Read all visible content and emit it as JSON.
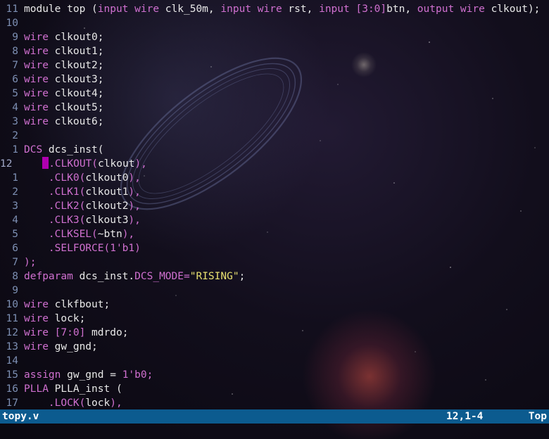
{
  "lines": [
    {
      "num": "11",
      "cur": false,
      "tokens": [
        {
          "t": "module top (",
          "c": ""
        },
        {
          "t": "input",
          "c": "kw"
        },
        {
          "t": " ",
          "c": ""
        },
        {
          "t": "wire",
          "c": "kw"
        },
        {
          "t": " clk_50m, ",
          "c": ""
        },
        {
          "t": "input",
          "c": "kw"
        },
        {
          "t": " ",
          "c": ""
        },
        {
          "t": "wire",
          "c": "kw"
        },
        {
          "t": " rst, ",
          "c": ""
        },
        {
          "t": "input",
          "c": "kw"
        },
        {
          "t": " [3:0]",
          "c": "kw"
        },
        {
          "t": "btn, ",
          "c": ""
        },
        {
          "t": "output",
          "c": "kw"
        },
        {
          "t": " ",
          "c": ""
        },
        {
          "t": "wire",
          "c": "kw"
        },
        {
          "t": " clkout);",
          "c": ""
        }
      ]
    },
    {
      "num": "10",
      "cur": false,
      "tokens": []
    },
    {
      "num": "9",
      "cur": false,
      "tokens": [
        {
          "t": "wire",
          "c": "kw"
        },
        {
          "t": " clkout0;",
          "c": ""
        }
      ]
    },
    {
      "num": "8",
      "cur": false,
      "tokens": [
        {
          "t": "wire",
          "c": "kw"
        },
        {
          "t": " clkout1;",
          "c": ""
        }
      ]
    },
    {
      "num": "7",
      "cur": false,
      "tokens": [
        {
          "t": "wire",
          "c": "kw"
        },
        {
          "t": " clkout2;",
          "c": ""
        }
      ]
    },
    {
      "num": "6",
      "cur": false,
      "tokens": [
        {
          "t": "wire",
          "c": "kw"
        },
        {
          "t": " clkout3;",
          "c": ""
        }
      ]
    },
    {
      "num": "5",
      "cur": false,
      "tokens": [
        {
          "t": "wire",
          "c": "kw"
        },
        {
          "t": " clkout4;",
          "c": ""
        }
      ]
    },
    {
      "num": "4",
      "cur": false,
      "tokens": [
        {
          "t": "wire",
          "c": "kw"
        },
        {
          "t": " clkout5;",
          "c": ""
        }
      ]
    },
    {
      "num": "3",
      "cur": false,
      "tokens": [
        {
          "t": "wire",
          "c": "kw"
        },
        {
          "t": " clkout6;",
          "c": ""
        }
      ]
    },
    {
      "num": "2",
      "cur": false,
      "tokens": []
    },
    {
      "num": "1",
      "cur": false,
      "tokens": [
        {
          "t": "DCS",
          "c": "kw"
        },
        {
          "t": " dcs_inst(",
          "c": ""
        }
      ]
    },
    {
      "num": "12",
      "cur": true,
      "cursorAt": 4,
      "tokens": [
        {
          "t": "    ",
          "c": ""
        },
        {
          "t": ".CLKOUT(",
          "c": "kw"
        },
        {
          "t": "clkout",
          "c": ""
        },
        {
          "t": "),",
          "c": "kw"
        }
      ]
    },
    {
      "num": "1",
      "cur": false,
      "tokens": [
        {
          "t": "    ",
          "c": ""
        },
        {
          "t": ".CLK0(",
          "c": "kw"
        },
        {
          "t": "clkout0",
          "c": ""
        },
        {
          "t": "),",
          "c": "kw"
        }
      ]
    },
    {
      "num": "2",
      "cur": false,
      "tokens": [
        {
          "t": "    ",
          "c": ""
        },
        {
          "t": ".CLK1(",
          "c": "kw"
        },
        {
          "t": "clkout1",
          "c": ""
        },
        {
          "t": "),",
          "c": "kw"
        }
      ]
    },
    {
      "num": "3",
      "cur": false,
      "tokens": [
        {
          "t": "    ",
          "c": ""
        },
        {
          "t": ".CLK2(",
          "c": "kw"
        },
        {
          "t": "clkout2",
          "c": ""
        },
        {
          "t": "),",
          "c": "kw"
        }
      ]
    },
    {
      "num": "4",
      "cur": false,
      "tokens": [
        {
          "t": "    ",
          "c": ""
        },
        {
          "t": ".CLK3(",
          "c": "kw"
        },
        {
          "t": "clkout3",
          "c": ""
        },
        {
          "t": "),",
          "c": "kw"
        }
      ]
    },
    {
      "num": "5",
      "cur": false,
      "tokens": [
        {
          "t": "    ",
          "c": ""
        },
        {
          "t": ".CLKSEL(",
          "c": "kw"
        },
        {
          "t": "~btn",
          "c": ""
        },
        {
          "t": "),",
          "c": "kw"
        }
      ]
    },
    {
      "num": "6",
      "cur": false,
      "tokens": [
        {
          "t": "    ",
          "c": ""
        },
        {
          "t": ".SELFORCE(1'b1)",
          "c": "kw"
        }
      ]
    },
    {
      "num": "7",
      "cur": false,
      "tokens": [
        {
          "t": ");",
          "c": "kw"
        }
      ]
    },
    {
      "num": "8",
      "cur": false,
      "tokens": [
        {
          "t": "defparam",
          "c": "kw"
        },
        {
          "t": " dcs_inst.",
          "c": ""
        },
        {
          "t": "DCS_MODE=",
          "c": "kw"
        },
        {
          "t": "\"RISING\"",
          "c": "str"
        },
        {
          "t": ";",
          "c": ""
        }
      ]
    },
    {
      "num": "9",
      "cur": false,
      "tokens": []
    },
    {
      "num": "10",
      "cur": false,
      "tokens": [
        {
          "t": "wire",
          "c": "kw"
        },
        {
          "t": " clkfbout;",
          "c": ""
        }
      ]
    },
    {
      "num": "11",
      "cur": false,
      "tokens": [
        {
          "t": "wire",
          "c": "kw"
        },
        {
          "t": " lock;",
          "c": ""
        }
      ]
    },
    {
      "num": "12",
      "cur": false,
      "tokens": [
        {
          "t": "wire",
          "c": "kw"
        },
        {
          "t": " [7:0]",
          "c": "kw"
        },
        {
          "t": " mdrdo;",
          "c": ""
        }
      ]
    },
    {
      "num": "13",
      "cur": false,
      "tokens": [
        {
          "t": "wire",
          "c": "kw"
        },
        {
          "t": " gw_gnd;",
          "c": ""
        }
      ]
    },
    {
      "num": "14",
      "cur": false,
      "tokens": []
    },
    {
      "num": "15",
      "cur": false,
      "tokens": [
        {
          "t": "assign",
          "c": "kw"
        },
        {
          "t": " gw_gnd = ",
          "c": ""
        },
        {
          "t": "1'b0;",
          "c": "kw"
        }
      ]
    },
    {
      "num": "16",
      "cur": false,
      "tokens": [
        {
          "t": "PLLA",
          "c": "kw"
        },
        {
          "t": " PLLA_inst (",
          "c": ""
        }
      ]
    },
    {
      "num": "17",
      "cur": false,
      "tokens": [
        {
          "t": "    ",
          "c": ""
        },
        {
          "t": ".LOCK(",
          "c": "kw"
        },
        {
          "t": "lock",
          "c": ""
        },
        {
          "t": "),",
          "c": "kw"
        }
      ]
    }
  ],
  "statusbar": {
    "filename": "topy.v",
    "position": "12,1-4",
    "scroll": "Top"
  },
  "colors": {
    "keyword": "#d070d0",
    "string": "#e8e070",
    "linenumber": "#7d8fb3",
    "statusbar_bg": "#0c5b8f",
    "cursor": "#b000b0"
  }
}
